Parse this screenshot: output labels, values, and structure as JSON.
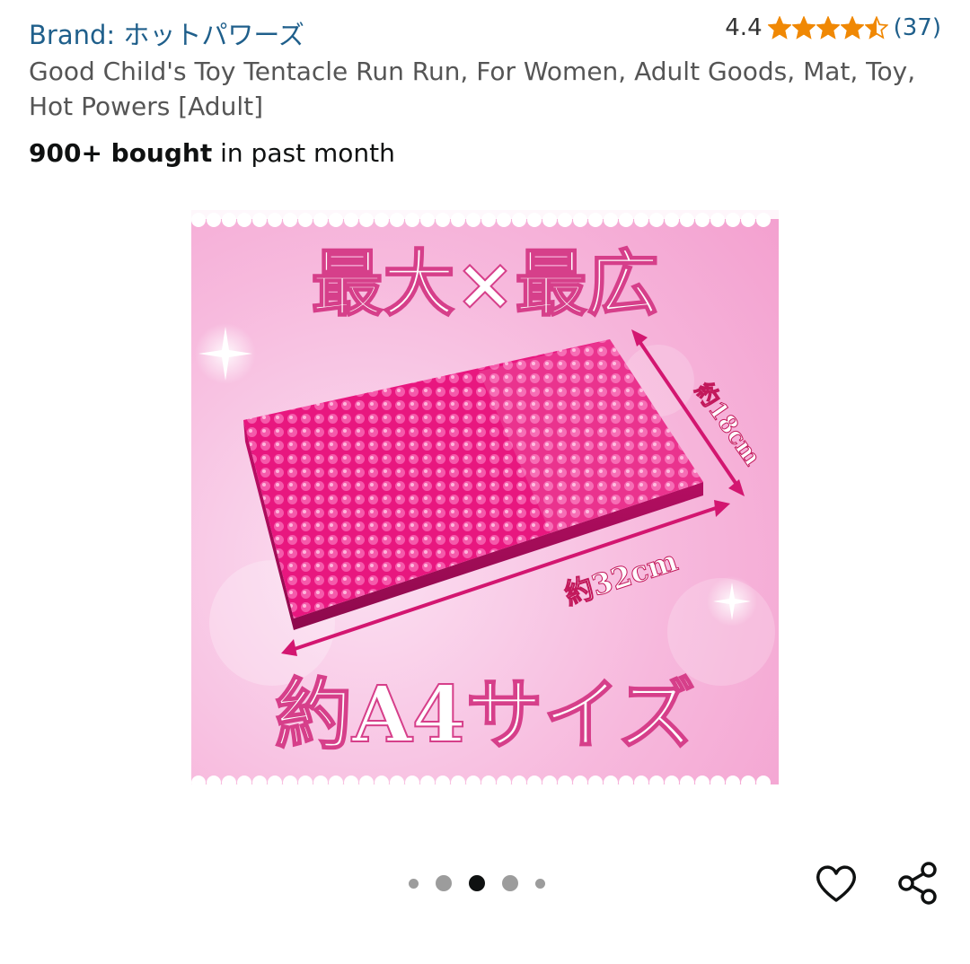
{
  "header": {
    "brand_label": "Brand: ホットパワーズ",
    "rating_value": "4.4",
    "rating_stars": 4.4,
    "rating_count": "(37)"
  },
  "product": {
    "title": "Good Child's Toy Tentacle Run Run, For Women, Adult Goods, Mat, Toy, Hot Powers  [Adult]",
    "bought_bold": "900+ bought",
    "bought_rest": " in past month"
  },
  "image": {
    "headline": "最大×最広",
    "width_label": "約18cm",
    "length_label": "約32cm",
    "size_label": "約A4サイズ"
  },
  "carousel": {
    "total": 5,
    "active_index": 2
  },
  "icons": {
    "wishlist": "heart-icon",
    "share": "share-icon"
  },
  "colors": {
    "brand_link": "#1f5f8b",
    "star": "#f08804",
    "mat_pink": "#ec1c86"
  }
}
